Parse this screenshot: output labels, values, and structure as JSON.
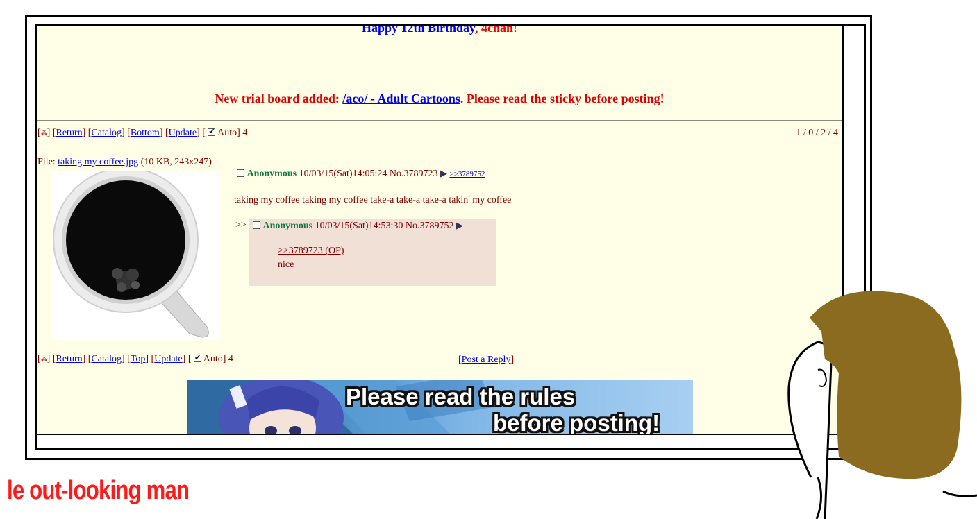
{
  "top_banner": {
    "link_text": "Happy 12th Birthday",
    "suffix": ", 4chan!"
  },
  "announcement": {
    "prefix": "New trial board added: ",
    "link_text": "/aco/ - Adult Cartoons",
    "suffix": ". Please read the sticky before posting!"
  },
  "navbar_top": {
    "return": "Return",
    "catalog": "Catalog",
    "bottom": "Bottom",
    "update": "Update",
    "auto_label": "Auto",
    "auto_checked": true,
    "count": "4"
  },
  "page_counts": "1 / 0 / 2 / 4",
  "op_post": {
    "file_label": "File: ",
    "file_name": "taking my coffee.jpg",
    "file_meta": " (10 KB, 243x247)",
    "name": "Anonymous",
    "datetime": "10/03/15(Sat)14:05:24",
    "number": "No.3789723",
    "backlink": ">>3789752",
    "comment": "taking my coffee taking my coffee take-a take-a take-a takin' my coffee"
  },
  "reply_post": {
    "side_arrows": ">>",
    "name": "Anonymous",
    "datetime": "10/03/15(Sat)14:53:30",
    "number": "No.3789752",
    "quotelink": ">>3789723 (OP)",
    "comment": "nice"
  },
  "navbar_bottom": {
    "return": "Return",
    "catalog": "Catalog",
    "top": "Top",
    "update": "Update",
    "auto_label": "Auto",
    "auto_checked": true,
    "count": "4"
  },
  "post_reply": "Post a Reply",
  "rules_banner": {
    "line1": "Please read the rules",
    "line2": "before posting!"
  },
  "caption": "le out-looking man",
  "colors": {
    "board_bg": "#ffffe7",
    "reply_bg": "#f0e0d6",
    "name_green": "#117743",
    "text_maroon": "#800000",
    "link_blue": "#0000ee",
    "caption_red": "#ff1a1a",
    "hair_brown": "#8b6b1f"
  }
}
